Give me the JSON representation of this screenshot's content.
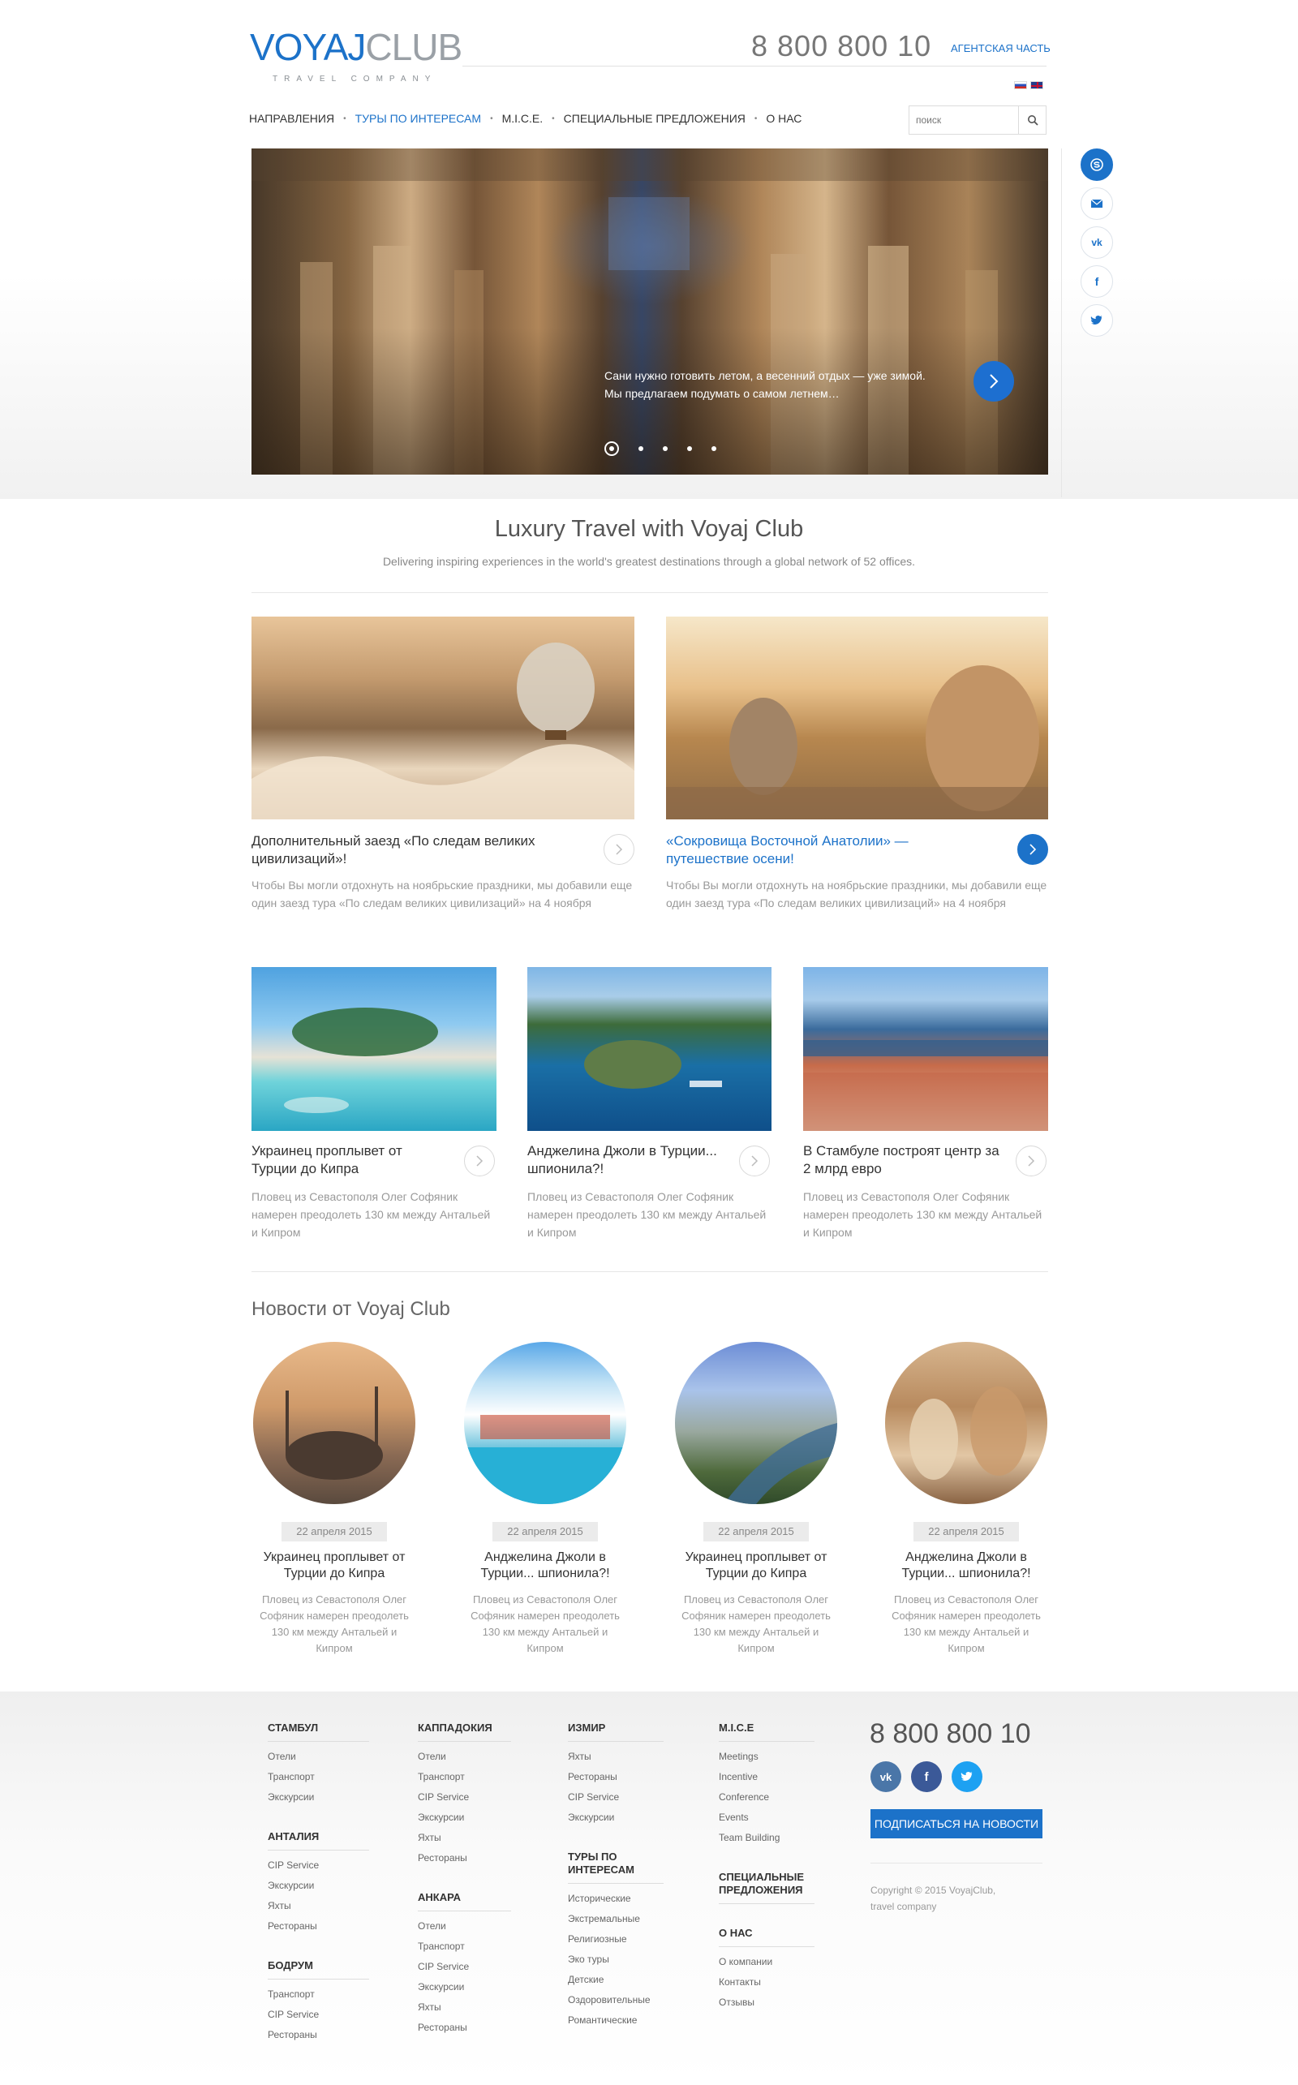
{
  "header": {
    "logo_main": "VOYAJ",
    "logo_club": "CLUB",
    "logo_sub": "TRAVEL COMPANY",
    "phone": "8 800 800 10",
    "agency_link": "АГЕНТСКАЯ ЧАСТЬ",
    "search_placeholder": "поиск"
  },
  "nav": {
    "items": [
      {
        "label": "НАПРАВЛЕНИЯ"
      },
      {
        "label": "ТУРЫ ПО ИНТЕРЕСАМ"
      },
      {
        "label": "M.I.C.E."
      },
      {
        "label": "СПЕЦИАЛЬНЫЕ ПРЕДЛОЖЕНИЯ"
      },
      {
        "label": "О НАС"
      }
    ],
    "active_index": 1
  },
  "hero": {
    "line1": "Сани нужно готовить летом, а весенний отдых — уже зимой.",
    "line2": "Мы предлагаем подумать о самом летнем…"
  },
  "intro": {
    "title": "Luxury Travel with Voyaj Club",
    "subtitle": "Delivering inspiring experiences in the world's greatest destinations through a global network of 52 offices."
  },
  "features": [
    {
      "title": "Дополнительный заезд «По следам великих цивилизаций»!",
      "text": "Чтобы Вы могли отдохнуть на ноябрьские праздники, мы добавили еще один заезд тура «По следам великих цивилизаций» на 4 ноября"
    },
    {
      "title": "«Сокровища Восточной Анатолии» — путешествие осени!",
      "text": "Чтобы Вы могли отдохнуть на ноябрьские праздники, мы добавили еще один заезд тура «По следам великих цивилизаций» на 4 ноября"
    }
  ],
  "cards": [
    {
      "title": "Украинец проплывет от Турции до Кипра",
      "text": "Пловец из Севастополя Олег Софяник намерен преодолеть 130 км между Антальей и Кипром"
    },
    {
      "title": "Анджелина Джоли в Турции... шпионила?!",
      "text": "Пловец из Севастополя Олег Софяник намерен преодолеть 130 км между Антальей и Кипром"
    },
    {
      "title": "В Стамбуле построят центр за 2 млрд евро",
      "text": "Пловец из Севастополя Олег Софяник намерен преодолеть 130 км между Антальей и Кипром"
    }
  ],
  "news": {
    "heading": "Новости от Voyaj Club",
    "items": [
      {
        "date": "22 апреля 2015",
        "title": "Украинец проплывет от Турции до Кипра",
        "text": "Пловец из Севастополя Олег Софяник намерен преодолеть 130 км между Антальей и Кипром"
      },
      {
        "date": "22 апреля 2015",
        "title": "Анджелина Джоли в Турции... шпионила?!",
        "text": "Пловец из Севастополя Олег Софяник намерен преодолеть 130 км между Антальей и Кипром"
      },
      {
        "date": "22 апреля 2015",
        "title": "Украинец проплывет от Турции до Кипра",
        "text": "Пловец из Севастополя Олег Софяник намерен преодолеть 130 км между Антальей и Кипром"
      },
      {
        "date": "22 апреля 2015",
        "title": "Анджелина Джоли в Турции... шпионила?!",
        "text": "Пловец из Севастополя Олег Софяник намерен преодолеть 130 км между Антальей и Кипром"
      }
    ]
  },
  "footer": {
    "col1": [
      {
        "head": "СТАМБУЛ",
        "links": [
          "Отели",
          "Транспорт",
          "Экскурсии"
        ]
      },
      {
        "head": "АНТАЛИЯ",
        "links": [
          "CIP Service",
          "Экскурсии",
          "Яхты",
          "Рестораны"
        ]
      },
      {
        "head": "БОДРУМ",
        "links": [
          "Транспорт",
          "CIP Service",
          "Рестораны"
        ]
      }
    ],
    "col2": [
      {
        "head": "КАППАДОКИЯ",
        "links": [
          "Отели",
          "Транспорт",
          "CIP Service",
          "Экскурсии",
          "Яхты",
          "Рестораны"
        ]
      },
      {
        "head": "АНКАРА",
        "links": [
          "Отели",
          "Транспорт",
          "CIP Service",
          "Экскурсии",
          "Яхты",
          "Рестораны"
        ]
      }
    ],
    "col3": [
      {
        "head": "ИЗМИР",
        "links": [
          "Яхты",
          "Рестораны",
          "CIP Service",
          "Экскурсии"
        ]
      },
      {
        "head": "ТУРЫ ПО ИНТЕРЕСАМ",
        "links": [
          "Исторические",
          "Экстремальные",
          "Религиозные",
          "Эко туры",
          "Детские",
          "Оздоровительные",
          "Романтические"
        ]
      }
    ],
    "col4": [
      {
        "head": "M.I.C.E",
        "links": [
          "Meetings",
          "Incentive",
          "Conference",
          "Events",
          "Team Building"
        ]
      },
      {
        "head": "СПЕЦИАЛЬНЫЕ ПРЕДЛОЖЕНИЯ",
        "links": []
      },
      {
        "head": "О НАС",
        "links": [
          "О компании",
          "Контакты",
          "Отзывы"
        ]
      }
    ],
    "phone": "8 800 800 10",
    "subscribe": "ПОДПИСАТЬСЯ НА НОВОСТИ",
    "copyright_1": "Copyright © 2015 VoyajClub,",
    "copyright_2": "travel company"
  },
  "colors": {
    "accent": "#1c72c9",
    "vk": "#4a76a8",
    "fb": "#3b5998",
    "tw": "#1da1f2"
  },
  "icons": [
    "search-icon",
    "arrow-right-icon",
    "skype-icon",
    "mail-icon",
    "vk-icon",
    "facebook-icon",
    "twitter-icon"
  ]
}
